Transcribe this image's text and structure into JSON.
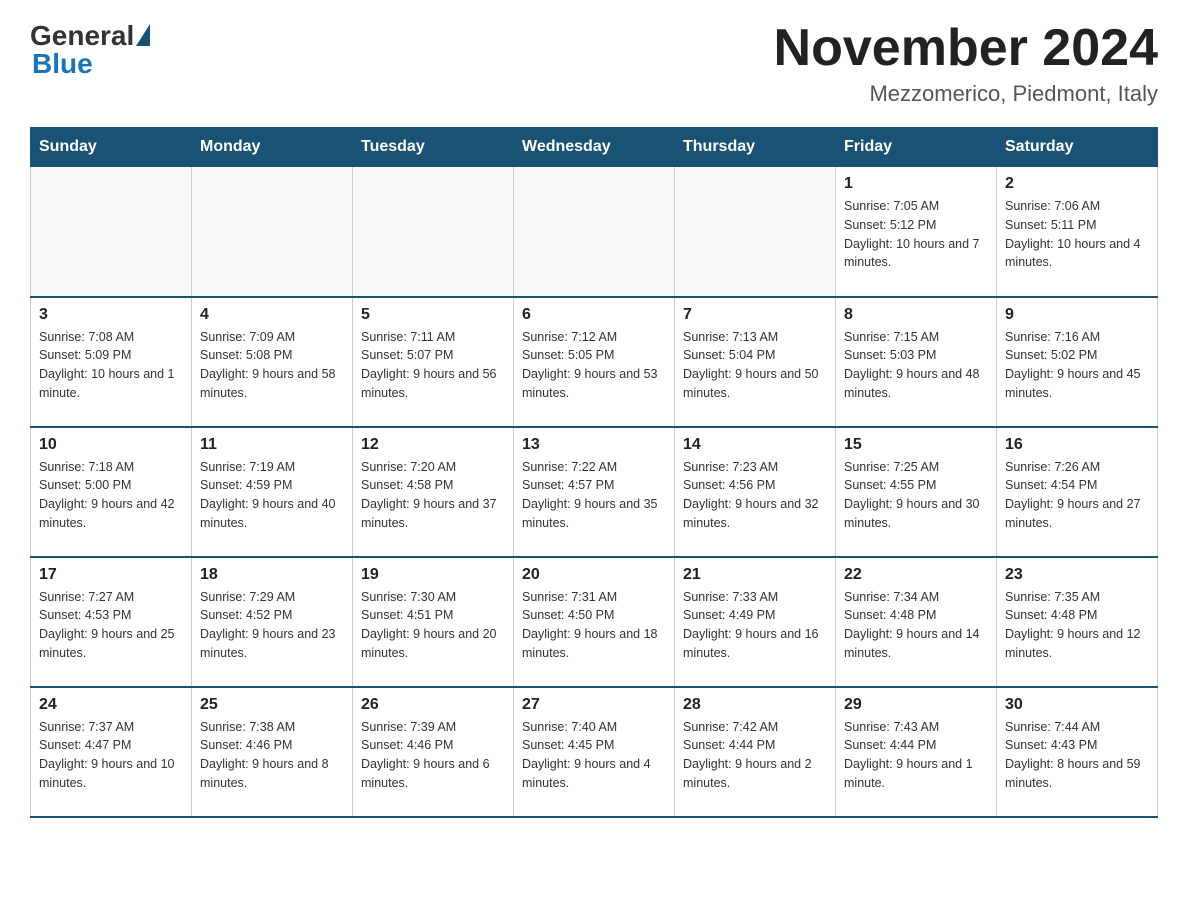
{
  "header": {
    "logo_general": "General",
    "logo_blue": "Blue",
    "month_year": "November 2024",
    "location": "Mezzomerico, Piedmont, Italy"
  },
  "days_of_week": [
    "Sunday",
    "Monday",
    "Tuesday",
    "Wednesday",
    "Thursday",
    "Friday",
    "Saturday"
  ],
  "weeks": [
    [
      {
        "day": "",
        "info": ""
      },
      {
        "day": "",
        "info": ""
      },
      {
        "day": "",
        "info": ""
      },
      {
        "day": "",
        "info": ""
      },
      {
        "day": "",
        "info": ""
      },
      {
        "day": "1",
        "info": "Sunrise: 7:05 AM\nSunset: 5:12 PM\nDaylight: 10 hours and 7 minutes."
      },
      {
        "day": "2",
        "info": "Sunrise: 7:06 AM\nSunset: 5:11 PM\nDaylight: 10 hours and 4 minutes."
      }
    ],
    [
      {
        "day": "3",
        "info": "Sunrise: 7:08 AM\nSunset: 5:09 PM\nDaylight: 10 hours and 1 minute."
      },
      {
        "day": "4",
        "info": "Sunrise: 7:09 AM\nSunset: 5:08 PM\nDaylight: 9 hours and 58 minutes."
      },
      {
        "day": "5",
        "info": "Sunrise: 7:11 AM\nSunset: 5:07 PM\nDaylight: 9 hours and 56 minutes."
      },
      {
        "day": "6",
        "info": "Sunrise: 7:12 AM\nSunset: 5:05 PM\nDaylight: 9 hours and 53 minutes."
      },
      {
        "day": "7",
        "info": "Sunrise: 7:13 AM\nSunset: 5:04 PM\nDaylight: 9 hours and 50 minutes."
      },
      {
        "day": "8",
        "info": "Sunrise: 7:15 AM\nSunset: 5:03 PM\nDaylight: 9 hours and 48 minutes."
      },
      {
        "day": "9",
        "info": "Sunrise: 7:16 AM\nSunset: 5:02 PM\nDaylight: 9 hours and 45 minutes."
      }
    ],
    [
      {
        "day": "10",
        "info": "Sunrise: 7:18 AM\nSunset: 5:00 PM\nDaylight: 9 hours and 42 minutes."
      },
      {
        "day": "11",
        "info": "Sunrise: 7:19 AM\nSunset: 4:59 PM\nDaylight: 9 hours and 40 minutes."
      },
      {
        "day": "12",
        "info": "Sunrise: 7:20 AM\nSunset: 4:58 PM\nDaylight: 9 hours and 37 minutes."
      },
      {
        "day": "13",
        "info": "Sunrise: 7:22 AM\nSunset: 4:57 PM\nDaylight: 9 hours and 35 minutes."
      },
      {
        "day": "14",
        "info": "Sunrise: 7:23 AM\nSunset: 4:56 PM\nDaylight: 9 hours and 32 minutes."
      },
      {
        "day": "15",
        "info": "Sunrise: 7:25 AM\nSunset: 4:55 PM\nDaylight: 9 hours and 30 minutes."
      },
      {
        "day": "16",
        "info": "Sunrise: 7:26 AM\nSunset: 4:54 PM\nDaylight: 9 hours and 27 minutes."
      }
    ],
    [
      {
        "day": "17",
        "info": "Sunrise: 7:27 AM\nSunset: 4:53 PM\nDaylight: 9 hours and 25 minutes."
      },
      {
        "day": "18",
        "info": "Sunrise: 7:29 AM\nSunset: 4:52 PM\nDaylight: 9 hours and 23 minutes."
      },
      {
        "day": "19",
        "info": "Sunrise: 7:30 AM\nSunset: 4:51 PM\nDaylight: 9 hours and 20 minutes."
      },
      {
        "day": "20",
        "info": "Sunrise: 7:31 AM\nSunset: 4:50 PM\nDaylight: 9 hours and 18 minutes."
      },
      {
        "day": "21",
        "info": "Sunrise: 7:33 AM\nSunset: 4:49 PM\nDaylight: 9 hours and 16 minutes."
      },
      {
        "day": "22",
        "info": "Sunrise: 7:34 AM\nSunset: 4:48 PM\nDaylight: 9 hours and 14 minutes."
      },
      {
        "day": "23",
        "info": "Sunrise: 7:35 AM\nSunset: 4:48 PM\nDaylight: 9 hours and 12 minutes."
      }
    ],
    [
      {
        "day": "24",
        "info": "Sunrise: 7:37 AM\nSunset: 4:47 PM\nDaylight: 9 hours and 10 minutes."
      },
      {
        "day": "25",
        "info": "Sunrise: 7:38 AM\nSunset: 4:46 PM\nDaylight: 9 hours and 8 minutes."
      },
      {
        "day": "26",
        "info": "Sunrise: 7:39 AM\nSunset: 4:46 PM\nDaylight: 9 hours and 6 minutes."
      },
      {
        "day": "27",
        "info": "Sunrise: 7:40 AM\nSunset: 4:45 PM\nDaylight: 9 hours and 4 minutes."
      },
      {
        "day": "28",
        "info": "Sunrise: 7:42 AM\nSunset: 4:44 PM\nDaylight: 9 hours and 2 minutes."
      },
      {
        "day": "29",
        "info": "Sunrise: 7:43 AM\nSunset: 4:44 PM\nDaylight: 9 hours and 1 minute."
      },
      {
        "day": "30",
        "info": "Sunrise: 7:44 AM\nSunset: 4:43 PM\nDaylight: 8 hours and 59 minutes."
      }
    ]
  ]
}
